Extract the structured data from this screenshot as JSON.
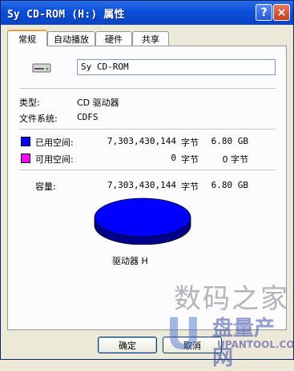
{
  "window": {
    "title": "Sy CD-ROM (H:) 属性",
    "help_glyph": "?",
    "close_glyph": "×"
  },
  "tabs": [
    {
      "label": "常规",
      "active": true
    },
    {
      "label": "自动播放",
      "active": false
    },
    {
      "label": "硬件",
      "active": false
    },
    {
      "label": "共享",
      "active": false
    }
  ],
  "general": {
    "drive_icon": "cd-drive-icon",
    "volume_label": "Sy CD-ROM",
    "type_label": "类型:",
    "type_value": "CD 驱动器",
    "fs_label": "文件系统:",
    "fs_value": "CDFS",
    "used": {
      "label": "已用空间:",
      "bytes": "7,303,430,144",
      "unit": "字节",
      "size": "6.80 GB",
      "color": "#0000ff"
    },
    "free": {
      "label": "可用空间:",
      "bytes": "0",
      "unit": "字节",
      "size": "0 字节",
      "color": "#ff00ff"
    },
    "capacity": {
      "label": "容量:",
      "bytes": "7,303,430,144",
      "unit": "字节",
      "size": "6.80 GB"
    },
    "drive_caption": "驱动器 H",
    "used_fraction": 1.0
  },
  "buttons": {
    "ok": "确定",
    "cancel": "取消"
  },
  "watermark": {
    "line1": "数码之家",
    "line2": "盘量产网",
    "line3": "UPANTOOL.COM",
    "u_glyph": "U"
  }
}
